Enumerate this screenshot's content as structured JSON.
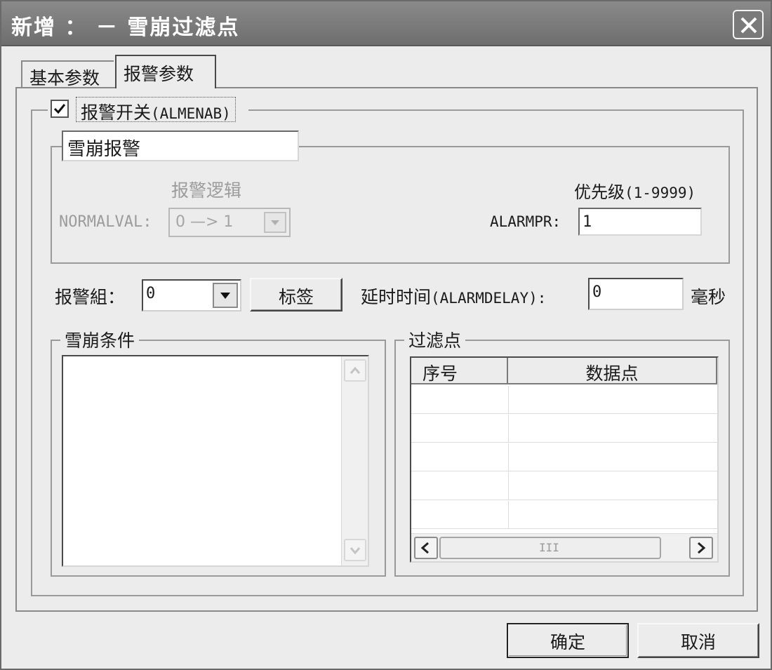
{
  "window": {
    "title": "新增 ： － 雪崩过滤点",
    "close_icon": "close-icon"
  },
  "tabs": [
    {
      "label": "基本参数",
      "active": false
    },
    {
      "label": "报警参数",
      "active": true
    }
  ],
  "alarm_switch": {
    "label": "报警开关",
    "code": "(ALMENAB)",
    "checked": true
  },
  "alarm_name": {
    "value": "雪崩报警"
  },
  "alarm_logic": {
    "heading": "报警逻辑",
    "normalval_label": "NORMALVAL:",
    "normalval_value": "0 —> 1"
  },
  "priority": {
    "label": "优先级",
    "range": "(1-9999)",
    "alarmpr_label": "ALARMPR:",
    "value": "1"
  },
  "alarm_group": {
    "label": "报警組：",
    "value": "0",
    "tag_button": "标签"
  },
  "delay": {
    "label": "延时时间",
    "code": "(ALARMDELAY):",
    "value": "0",
    "unit": "毫秒"
  },
  "avalanche_condition": {
    "legend": "雪崩条件"
  },
  "filter_points": {
    "legend": "过滤点",
    "columns": [
      "序号",
      "数据点"
    ],
    "scroll_thumb_grip": "III"
  },
  "footer": {
    "ok": "确定",
    "cancel": "取消"
  }
}
